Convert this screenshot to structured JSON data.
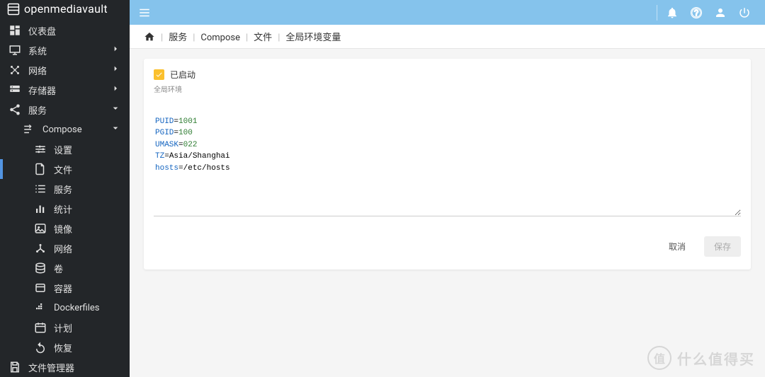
{
  "brand": "openmediavault",
  "topbar": {
    "icons": [
      "bell-icon",
      "help-icon",
      "user-icon",
      "power-icon"
    ]
  },
  "breadcrumb": {
    "items": [
      "服务",
      "Compose",
      "文件",
      "全局环境变量"
    ]
  },
  "sidebar": {
    "items": [
      {
        "icon": "dashboard-icon",
        "label": "仪表盘",
        "level": 0,
        "expand": null
      },
      {
        "icon": "display-icon",
        "label": "系统",
        "level": 0,
        "expand": "right"
      },
      {
        "icon": "network-icon",
        "label": "网络",
        "level": 0,
        "expand": "right"
      },
      {
        "icon": "storage-icon",
        "label": "存储器",
        "level": 0,
        "expand": "right"
      },
      {
        "icon": "share-icon",
        "label": "服务",
        "level": 0,
        "expand": "down"
      },
      {
        "icon": "compose-icon",
        "label": "Compose",
        "level": 1,
        "expand": "down"
      },
      {
        "icon": "tune-icon",
        "label": "设置",
        "level": 2,
        "expand": null
      },
      {
        "icon": "file-icon",
        "label": "文件",
        "level": 2,
        "expand": null,
        "active": true
      },
      {
        "icon": "list-icon",
        "label": "服务",
        "level": 2,
        "expand": null
      },
      {
        "icon": "stats-icon",
        "label": "统计",
        "level": 2,
        "expand": null
      },
      {
        "icon": "image-icon",
        "label": "镜像",
        "level": 2,
        "expand": null
      },
      {
        "icon": "net2-icon",
        "label": "网络",
        "level": 2,
        "expand": null
      },
      {
        "icon": "volume-icon",
        "label": "卷",
        "level": 2,
        "expand": null
      },
      {
        "icon": "container-icon",
        "label": "容器",
        "level": 2,
        "expand": null
      },
      {
        "icon": "docker-icon",
        "label": "Dockerfiles",
        "level": 2,
        "expand": null
      },
      {
        "icon": "schedule-icon",
        "label": "计划",
        "level": 2,
        "expand": null
      },
      {
        "icon": "restore-icon",
        "label": "恢复",
        "level": 2,
        "expand": null
      },
      {
        "icon": "save-icon",
        "label": "文件管理器",
        "level": 0,
        "expand": null
      }
    ]
  },
  "form": {
    "checkbox_label": "已启动",
    "checkbox_checked": true,
    "field_label": "全局环境",
    "env_lines": [
      {
        "key": "PUID",
        "val": "1001",
        "num": true
      },
      {
        "key": "PGID",
        "val": "100",
        "num": true
      },
      {
        "key": "UMASK",
        "val": "022",
        "num": true
      },
      {
        "key": "TZ",
        "val": "Asia/Shanghai",
        "num": false
      },
      {
        "key": "hosts",
        "val": "/etc/hosts",
        "num": false
      }
    ],
    "cancel_label": "取消",
    "save_label": "保存"
  },
  "watermark": {
    "char": "值",
    "text": "什么值得买"
  }
}
